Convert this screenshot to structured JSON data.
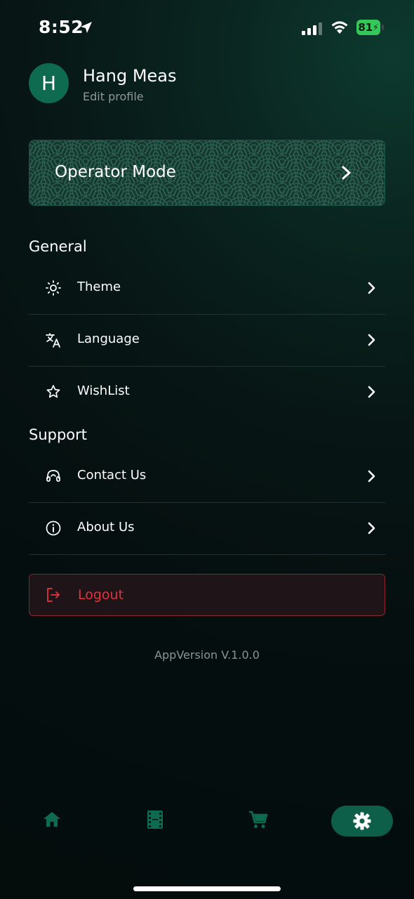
{
  "status_bar": {
    "time": "8:52",
    "battery": "81"
  },
  "profile": {
    "initial": "H",
    "name": "Hang Meas",
    "edit_label": "Edit profile"
  },
  "operator": {
    "label": "Operator Mode"
  },
  "general": {
    "heading": "General",
    "items": [
      {
        "label": "Theme",
        "icon": "sun-icon"
      },
      {
        "label": "Language",
        "icon": "translate-icon"
      },
      {
        "label": "WishList",
        "icon": "star-icon"
      }
    ]
  },
  "support": {
    "heading": "Support",
    "items": [
      {
        "label": "Contact Us",
        "icon": "headset-icon"
      },
      {
        "label": "About Us",
        "icon": "info-icon"
      }
    ]
  },
  "logout": {
    "label": "Logout",
    "color": "#e2333f"
  },
  "app_version": "AppVersion V.1.0.0",
  "tabs": [
    {
      "icon": "home-icon"
    },
    {
      "icon": "film-icon"
    },
    {
      "icon": "cart-icon"
    },
    {
      "icon": "gear-icon",
      "active": true
    }
  ],
  "colors": {
    "accent": "#0e6b50",
    "active_tab": "#0e5f49"
  }
}
